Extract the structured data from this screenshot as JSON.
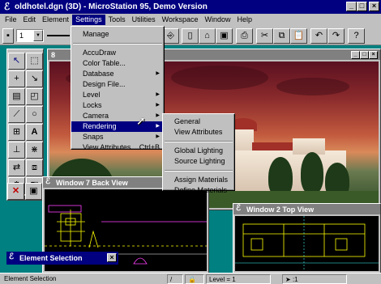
{
  "app": {
    "title": "oldhotel.dgn (3D) - MicroStation 95, Demo Version",
    "icon": "microstation-logo-icon",
    "window_buttons": [
      "_",
      "□",
      "×"
    ]
  },
  "menubar": [
    "File",
    "Edit",
    "Element",
    "Settings",
    "Tools",
    "Utilities",
    "Workspace",
    "Window",
    "Help"
  ],
  "toolbar": {
    "level_value": "1",
    "icons": [
      "attributes-icon",
      "new-file-icon",
      "open-file-icon",
      "save-icon",
      "print-icon",
      "cut-icon",
      "copy-icon",
      "paste-icon",
      "undo-icon",
      "redo-icon",
      "help-icon"
    ]
  },
  "settings_menu": {
    "items": [
      {
        "label": "Manage",
        "submenu": false
      },
      {
        "label": "AccuDraw",
        "submenu": false
      },
      {
        "label": "Color Table...",
        "submenu": false
      },
      {
        "label": "Database",
        "submenu": true
      },
      {
        "label": "Design File...",
        "submenu": false
      },
      {
        "label": "Level",
        "submenu": true
      },
      {
        "label": "Locks",
        "submenu": true
      },
      {
        "label": "Camera",
        "submenu": true
      },
      {
        "label": "Rendering",
        "submenu": true,
        "highlighted": true
      },
      {
        "label": "Snaps",
        "submenu": true
      },
      {
        "label": "View Attributes",
        "accelerator": "Ctrl+B",
        "submenu": false
      }
    ]
  },
  "rendering_submenu": {
    "items": [
      "General",
      "View Attributes",
      "Global Lighting",
      "Source Lighting",
      "Assign Materials",
      "Define Materials"
    ]
  },
  "windows": {
    "render_view": {
      "title": "8"
    },
    "back_view": {
      "title": "Window 7 Back View"
    },
    "top_view": {
      "title": "Window 2 Top View"
    }
  },
  "element_selection": {
    "title": "Element Selection"
  },
  "status_bar": {
    "message": "Element Selection",
    "level": "Level = 1",
    "selection_count": ":1"
  },
  "colors": {
    "title_bar": "#000080",
    "chrome": "#c0c0c0",
    "desktop": "#008080",
    "cad_background": "#000000",
    "cad_lines": "#ffff00"
  }
}
